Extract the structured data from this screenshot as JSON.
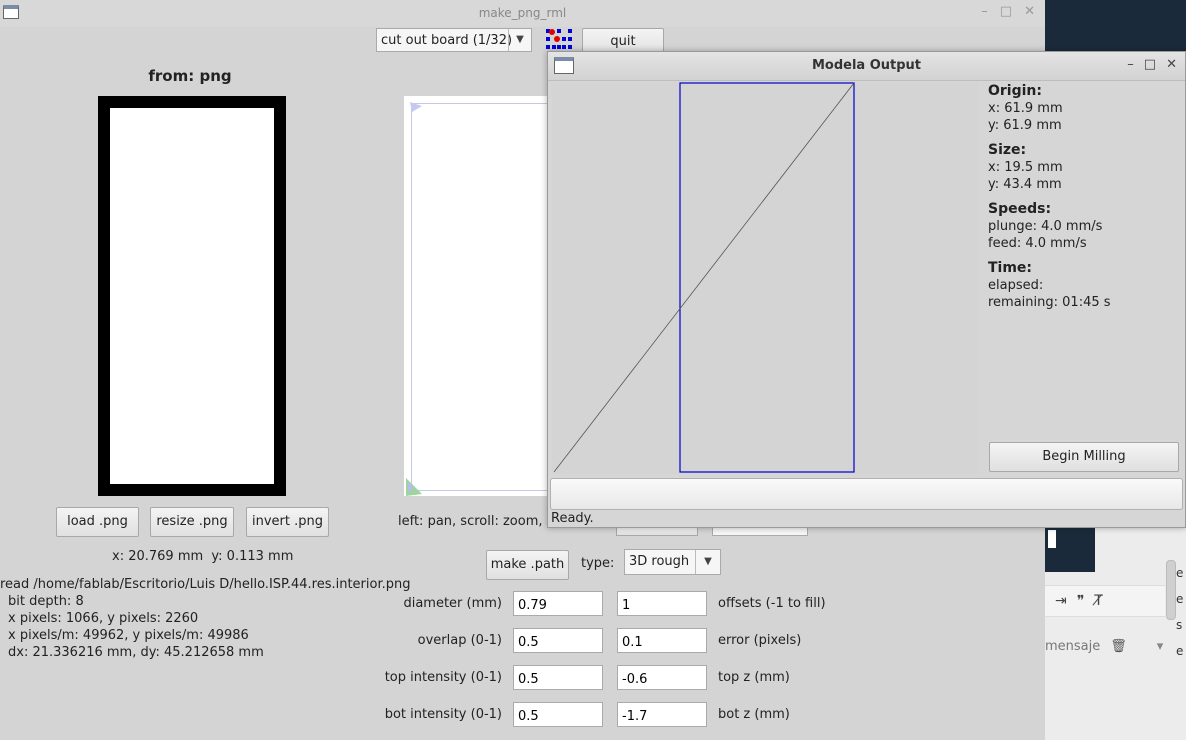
{
  "main_window": {
    "title": "make_png_rml",
    "controls": [
      "–",
      "□",
      "✕"
    ]
  },
  "toolbar": {
    "machine_select": "cut out board (1/32)",
    "quit_label": "quit"
  },
  "png_panel": {
    "title": "from: png",
    "load_label": "load .png",
    "resize_label": "resize .png",
    "invert_label": "invert .png",
    "coords": "x: 20.769 mm  y: 0.113 mm"
  },
  "file_info": {
    "path": "read /home/fablab/Escritorio/Luis D/hello.ISP.44.res.interior.png",
    "bit_depth": "bit depth: 8",
    "pixels": "x pixels: 1066, y pixels: 2260",
    "pixels_per_m": "x pixels/m: 49962, y pixels/m: 49986",
    "dims": "dx: 21.336216 mm, dy: 45.212658 mm"
  },
  "path_panel": {
    "hint": "left: pan, scroll: zoom, rig",
    "make_path_label": "make .path",
    "type_label": "type:",
    "type_value": "3D rough"
  },
  "params": [
    {
      "label": "diameter (mm)",
      "value1": "0.79",
      "value2": "1",
      "label2": "offsets (-1 to fill)"
    },
    {
      "label": "overlap (0-1)",
      "value1": "0.5",
      "value2": "0.1",
      "label2": "error (pixels)"
    },
    {
      "label": "top intensity (0-1)",
      "value1": "0.5",
      "value2": "-0.6",
      "label2": "top z (mm)"
    },
    {
      "label": "bot intensity (0-1)",
      "value1": "0.5",
      "value2": "-1.7",
      "label2": "bot z (mm)"
    }
  ],
  "modela": {
    "title": "Modela Output",
    "controls": [
      "–",
      "□",
      "✕"
    ],
    "origin_h": "Origin:",
    "origin_x": "x: 61.9 mm",
    "origin_y": "y: 61.9 mm",
    "size_h": "Size:",
    "size_x": "x: 19.5 mm",
    "size_y": "y: 43.4 mm",
    "speeds_h": "Speeds:",
    "plunge": "plunge: 4.0 mm/s",
    "feed": "feed: 4.0 mm/s",
    "time_h": "Time:",
    "elapsed": "elapsed:",
    "remaining": "remaining: 01:45 s",
    "begin_label": "Begin Milling",
    "status": "Ready."
  },
  "background": {
    "msg_fragment": "mensaje",
    "letters": [
      "e",
      "e",
      "s",
      "e"
    ]
  },
  "colors": {
    "path_blue": "#0000cc",
    "window_bg": "#d4d4d4"
  }
}
